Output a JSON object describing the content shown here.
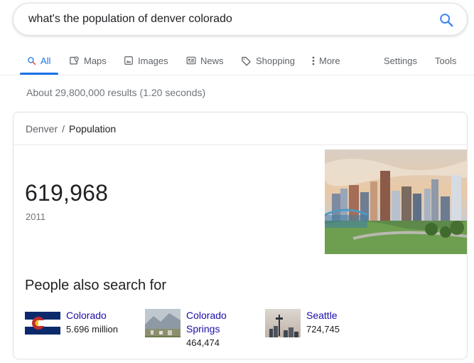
{
  "search": {
    "query": "what's the population of denver colorado"
  },
  "tabs": [
    {
      "label": "All",
      "icon": "search-icon",
      "active": true
    },
    {
      "label": "Maps",
      "icon": "map-pin-icon"
    },
    {
      "label": "Images",
      "icon": "image-icon"
    },
    {
      "label": "News",
      "icon": "news-icon"
    },
    {
      "label": "Shopping",
      "icon": "tag-icon"
    },
    {
      "label": "More",
      "icon": "more-vert-icon"
    }
  ],
  "tools": {
    "settings": "Settings",
    "tools": "Tools"
  },
  "results_count": "About 29,800,000 results (1.20 seconds)",
  "card": {
    "breadcrumb": {
      "entity": "Denver",
      "separator": "/",
      "attribute": "Population"
    },
    "population": "619,968",
    "year": "2011",
    "image": "denver-skyline-photo",
    "pasf_title": "People also search for",
    "pasf": [
      {
        "name": "Colorado",
        "value": "5.696 million",
        "thumb": "colorado-flag"
      },
      {
        "name": "Colorado Springs",
        "value": "464,474",
        "thumb": "colorado-springs-photo"
      },
      {
        "name": "Seattle",
        "value": "724,745",
        "thumb": "seattle-photo"
      }
    ]
  },
  "colors": {
    "accent": "#1a73e8",
    "link": "#1a0dab",
    "muted": "#70757a"
  }
}
